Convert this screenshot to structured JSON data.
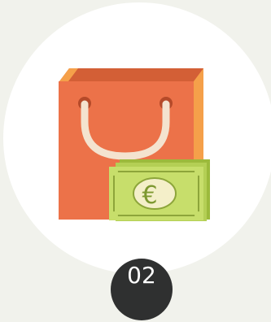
{
  "step": {
    "number": "02"
  },
  "illustration": {
    "bag_icon": "shopping-bag-icon",
    "money_icon": "banknote-icon",
    "currency_symbol": "€"
  },
  "colors": {
    "background": "#f1f2ec",
    "circle": "#ffffff",
    "bag_front": "#ec7249",
    "bag_side": "#f5a04a",
    "bag_top": "#d35f36",
    "handle": "#f4e3cf",
    "bill": "#c7de6b",
    "bill_dark": "#9cba3c",
    "badge": "#2f3030"
  }
}
